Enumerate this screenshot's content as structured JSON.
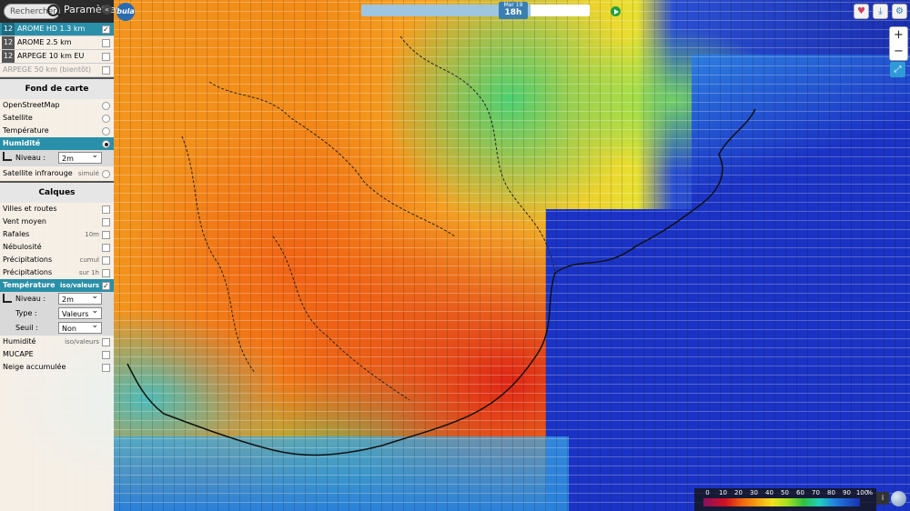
{
  "search": {
    "placeholder": "Rechercher"
  },
  "panel_title": "Paramètres",
  "logo_text": "bula",
  "timebar": {
    "day": "Mar 19",
    "hour": "18h"
  },
  "models": [
    {
      "num": "12",
      "label": "AROME HD 1.3 km",
      "checked": true
    },
    {
      "num": "12",
      "label": "AROME 2.5 km",
      "checked": false
    },
    {
      "num": "12",
      "label": "ARPEGE 10 km EU",
      "checked": false
    },
    {
      "label": "ARPEGE 50 km (bientôt)",
      "checked": false
    }
  ],
  "basemap": {
    "title": "Fond de carte",
    "items": [
      {
        "label": "OpenStreetMap"
      },
      {
        "label": "Satellite"
      },
      {
        "label": "Température"
      },
      {
        "label": "Humidité"
      }
    ],
    "niveau_label": "Niveau :",
    "niveau_value": "2m",
    "sat_ir_label": "Satellite infrarouge",
    "sat_ir_note": "simulé"
  },
  "layers": {
    "title": "Calques",
    "items": [
      {
        "label": "Villes et routes",
        "note": ""
      },
      {
        "label": "Vent moyen",
        "note": ""
      },
      {
        "label": "Rafales",
        "note": "10m"
      },
      {
        "label": "Nébulosité",
        "note": ""
      },
      {
        "label": "Précipitations",
        "note": "cumul"
      },
      {
        "label": "Précipitations",
        "note": "sur 1h"
      }
    ],
    "temperature": {
      "label": "Température",
      "note": "iso/valeurs",
      "niveau_label": "Niveau :",
      "niveau_value": "2m",
      "type_label": "Type :",
      "type_value": "Valeurs",
      "seuil_label": "Seuil :",
      "seuil_value": "Non"
    },
    "items2": [
      {
        "label": "Humidité",
        "note": "iso/valeurs"
      },
      {
        "label": "MUCAPE",
        "note": ""
      },
      {
        "label": "Neige accumulée",
        "note": ""
      }
    ]
  },
  "zoom": {
    "plus": "+",
    "minus": "−"
  },
  "legend": {
    "values": [
      "0",
      "10",
      "20",
      "30",
      "40",
      "50",
      "60",
      "70",
      "80",
      "90",
      "100"
    ],
    "unit": "%"
  },
  "colors": {
    "panel_accent": "#2a8fa8",
    "sea": "#1b33c4",
    "hot": "#d01020"
  }
}
